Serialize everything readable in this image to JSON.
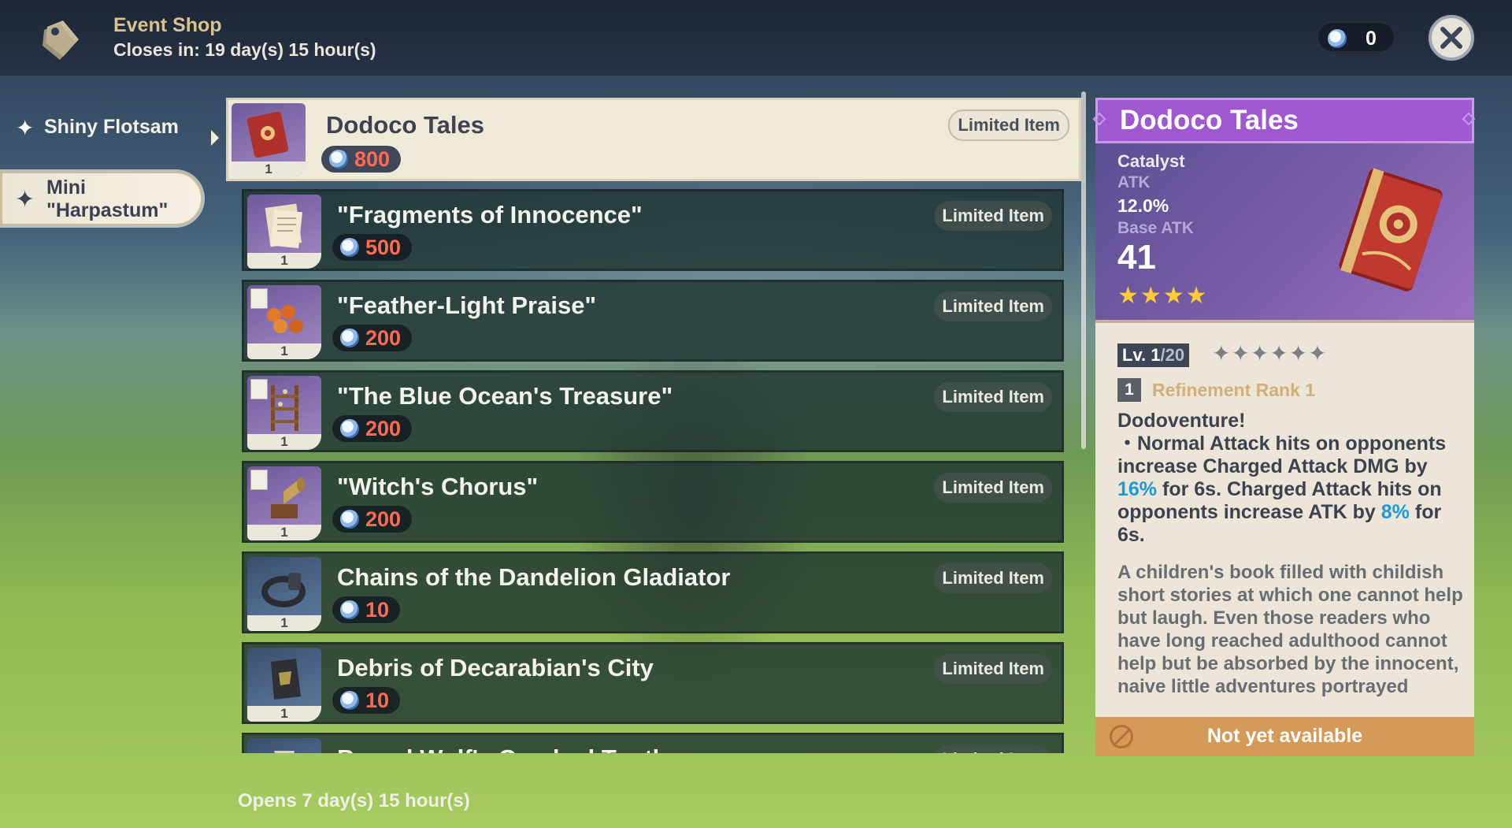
{
  "header": {
    "title": "Event Shop",
    "closes": "Closes in: 19 day(s) 15 hour(s)",
    "currency_value": "0"
  },
  "sidebar": {
    "items": [
      {
        "label": "Shiny Flotsam",
        "selected": false
      },
      {
        "label": "Mini\n\"Harpastum\"",
        "selected": true
      }
    ]
  },
  "items": [
    {
      "name": "Dodoco Tales",
      "price": "800",
      "qty": "1",
      "tag": "Limited Item",
      "icon": "book-icon",
      "selected": true
    },
    {
      "name": "\"Fragments of Innocence\"",
      "price": "500",
      "qty": "1",
      "tag": "Limited Item",
      "icon": "scroll-icon"
    },
    {
      "name": "\"Feather-Light Praise\"",
      "price": "200",
      "qty": "1",
      "tag": "Limited Item",
      "icon": "pastry-icon"
    },
    {
      "name": "\"The Blue Ocean's Treasure\"",
      "price": "200",
      "qty": "1",
      "tag": "Limited Item",
      "icon": "shelf-icon"
    },
    {
      "name": "\"Witch's Chorus\"",
      "price": "200",
      "qty": "1",
      "tag": "Limited Item",
      "icon": "gramophone-icon"
    },
    {
      "name": "Chains of the Dandelion Gladiator",
      "price": "10",
      "qty": "1",
      "tag": "Limited Item",
      "icon": "chains-icon"
    },
    {
      "name": "Debris of Decarabian's City",
      "price": "10",
      "qty": "1",
      "tag": "Limited Item",
      "icon": "debris-icon"
    },
    {
      "name": "Boreal Wolf's Cracked Tooth",
      "price": "",
      "qty": "",
      "tag": "Limited Item",
      "icon": "tooth-icon"
    }
  ],
  "footer": {
    "opens": "Opens 7 day(s) 15 hour(s)"
  },
  "detail": {
    "title": "Dodoco Tales",
    "type": "Catalyst",
    "sub_stat_label": "ATK",
    "sub_stat_value": "12.0%",
    "base_atk_label": "Base ATK",
    "base_atk_value": "41",
    "rarity_stars": 4,
    "rarity_text": "★★★★",
    "level_current": "Lv. 1",
    "level_max": "/20",
    "ascension_text": "✦✦✦✦✦✦",
    "refinement_num": "1",
    "refinement_label": "Refinement Rank 1",
    "passive_title": "Dodoventure!",
    "passive_l1": "・Normal Attack hits on opponents increase Charged Attack DMG by ",
    "passive_v1": "16%",
    "passive_l2": " for 6s. Charged Attack hits on opponents increase ATK by ",
    "passive_v2": "8%",
    "passive_l3": " for 6s.",
    "lore": "A children's book filled with childish short stories at which one cannot help but laugh. Even those readers who have long reached adulthood cannot help but be absorbed by the innocent, naive little adventures portrayed",
    "status": "Not yet available"
  },
  "colors": {
    "detail_header": "#9f58d0",
    "price_red": "#ff6a55",
    "highlight_blue": "#1b9ad8",
    "status_orange": "#d59a57",
    "refinement_gold": "#d2b079"
  }
}
